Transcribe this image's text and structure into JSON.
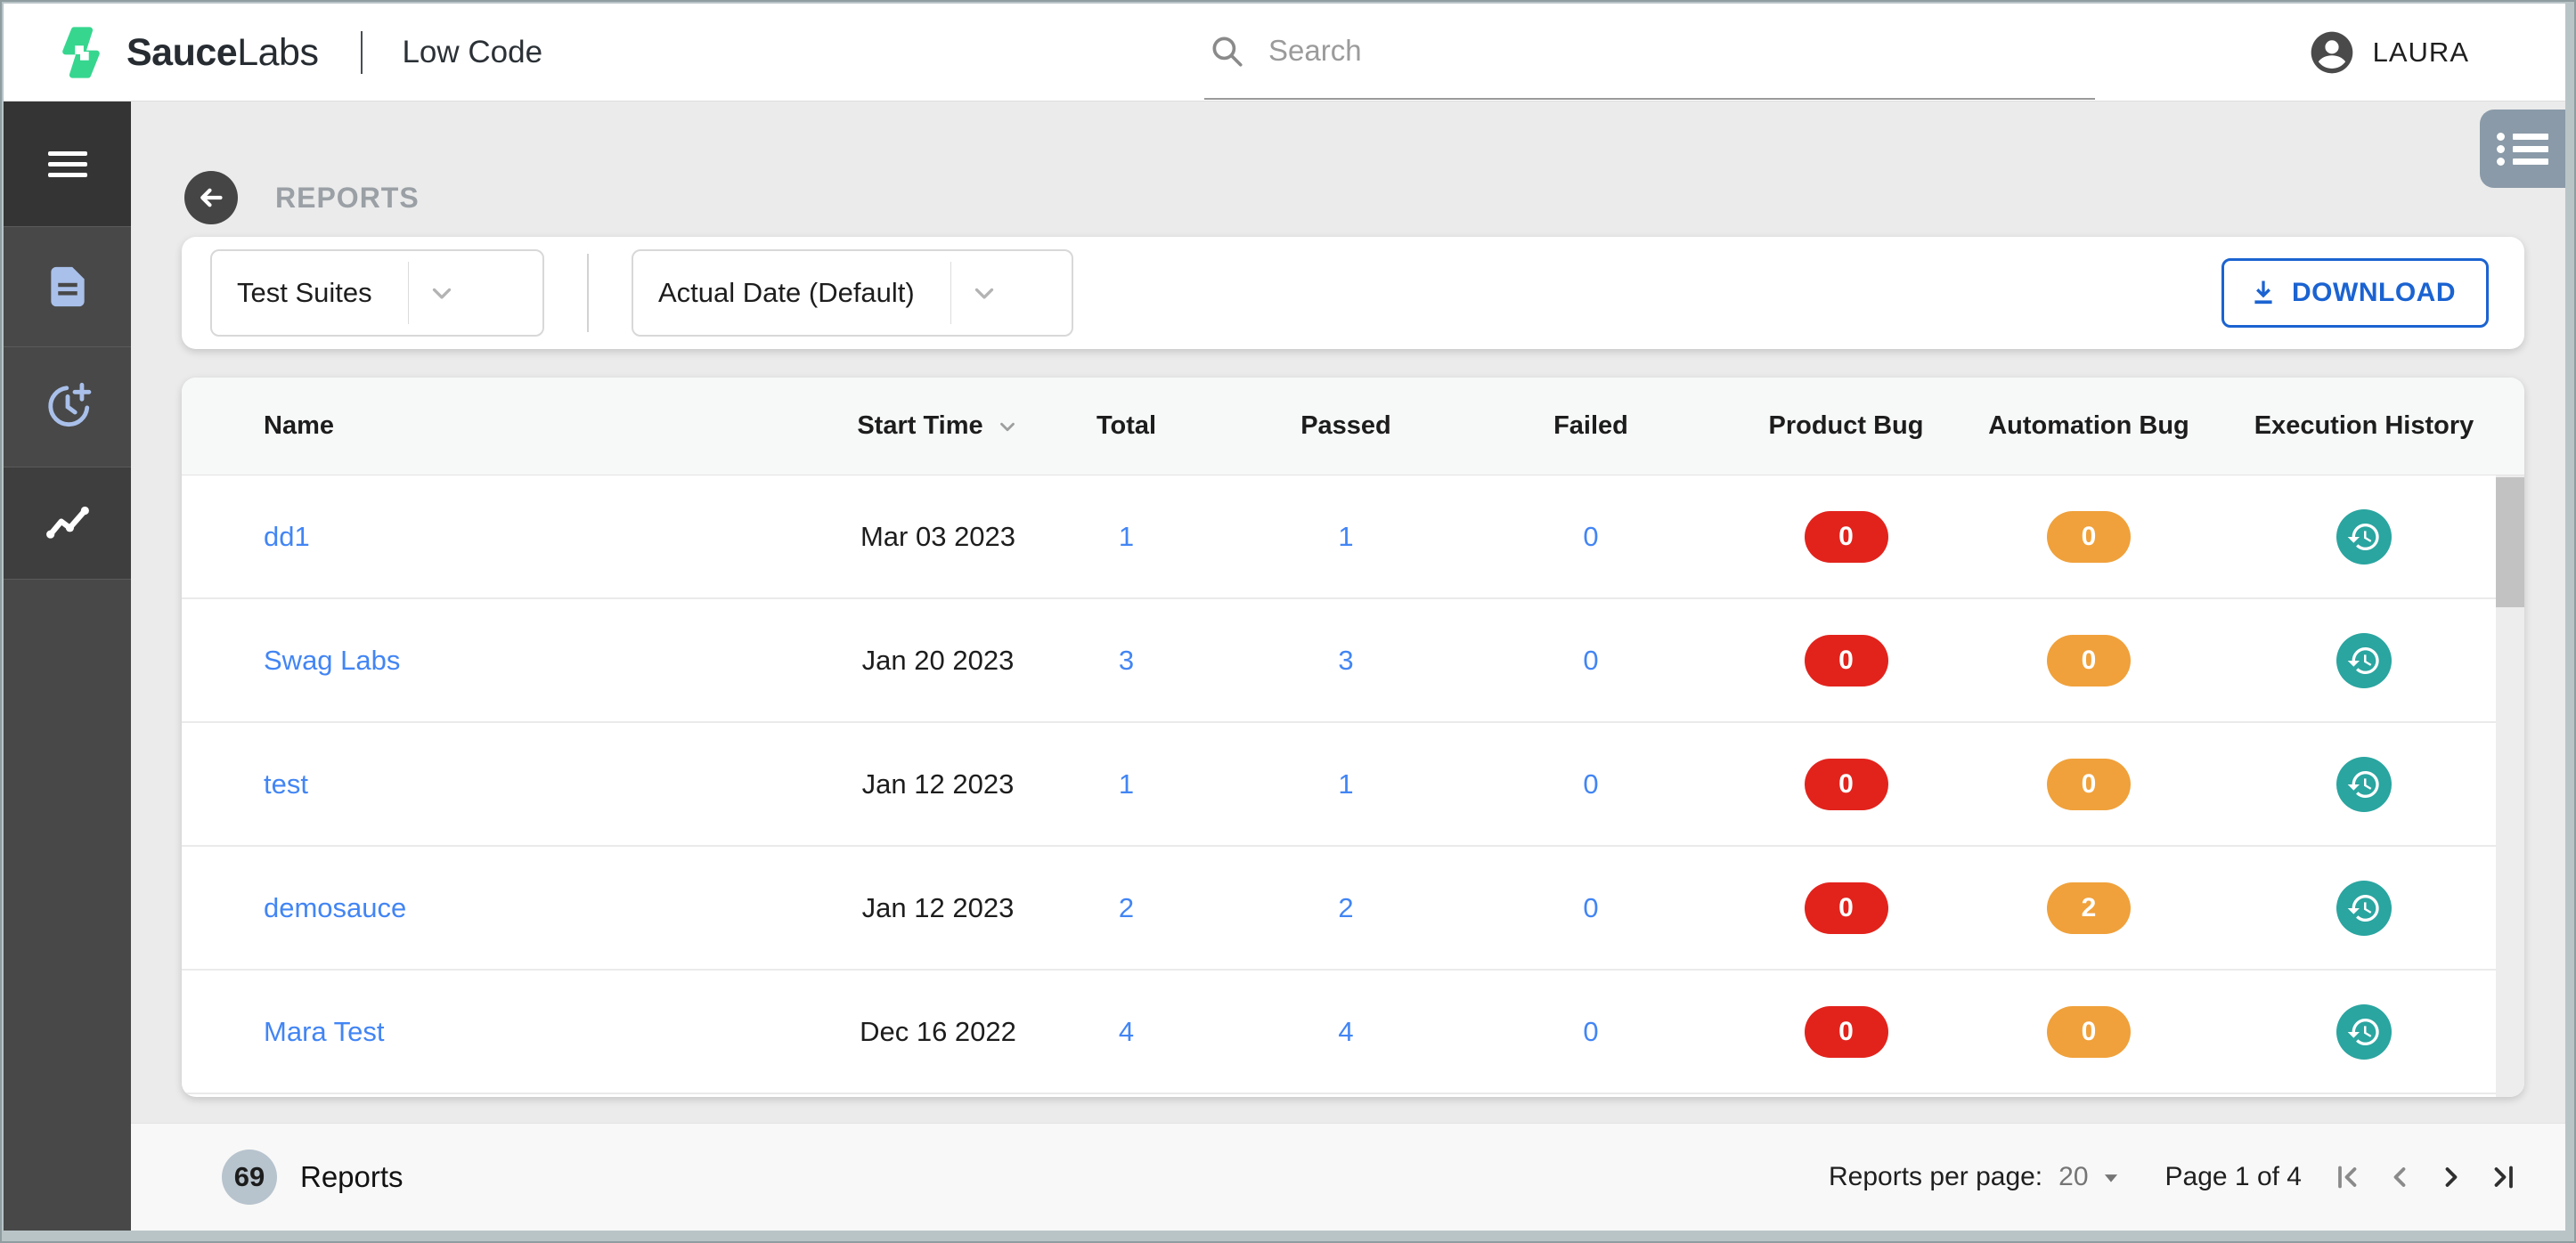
{
  "topbar": {
    "brand_bold": "Sauce",
    "brand_light": "Labs",
    "product": "Low Code",
    "search_placeholder": "Search",
    "username": "LAURA"
  },
  "sidebar": {
    "items": [
      {
        "id": "menu",
        "icon": "hamburger-icon"
      },
      {
        "id": "documents",
        "icon": "document-icon"
      },
      {
        "id": "schedule",
        "icon": "clock-plus-icon"
      },
      {
        "id": "reports",
        "icon": "trend-icon",
        "active": true
      }
    ]
  },
  "page": {
    "title": "REPORTS"
  },
  "filters": {
    "suite": {
      "value": "Test Suites"
    },
    "date": {
      "value": "Actual Date (Default)"
    },
    "download_label": "DOWNLOAD"
  },
  "table": {
    "columns": [
      "Name",
      "Start Time",
      "Total",
      "Passed",
      "Failed",
      "Product Bug",
      "Automation Bug",
      "Execution History"
    ],
    "rows": [
      {
        "name": "dd1",
        "start_time": "Mar 03 2023",
        "total": "1",
        "passed": "1",
        "failed": "0",
        "product_bug": "0",
        "automation_bug": "0"
      },
      {
        "name": "Swag Labs",
        "start_time": "Jan 20 2023",
        "total": "3",
        "passed": "3",
        "failed": "0",
        "product_bug": "0",
        "automation_bug": "0"
      },
      {
        "name": "test",
        "start_time": "Jan 12 2023",
        "total": "1",
        "passed": "1",
        "failed": "0",
        "product_bug": "0",
        "automation_bug": "0"
      },
      {
        "name": "demosauce",
        "start_time": "Jan 12 2023",
        "total": "2",
        "passed": "2",
        "failed": "0",
        "product_bug": "0",
        "automation_bug": "2"
      },
      {
        "name": "Mara Test",
        "start_time": "Dec 16 2022",
        "total": "4",
        "passed": "4",
        "failed": "0",
        "product_bug": "0",
        "automation_bug": "0"
      }
    ]
  },
  "footer": {
    "count": "69",
    "count_label": "Reports",
    "per_page_label": "Reports per page:",
    "per_page_value": "20",
    "page_info": "Page 1 of 4"
  },
  "colors": {
    "link_blue": "#4285f4",
    "download_blue": "#1b63d1",
    "product_bug_red": "#e2231c",
    "automation_bug_orange": "#f0a13b",
    "execution_teal": "#2aa5a0",
    "brand_green": "#36d68f"
  }
}
